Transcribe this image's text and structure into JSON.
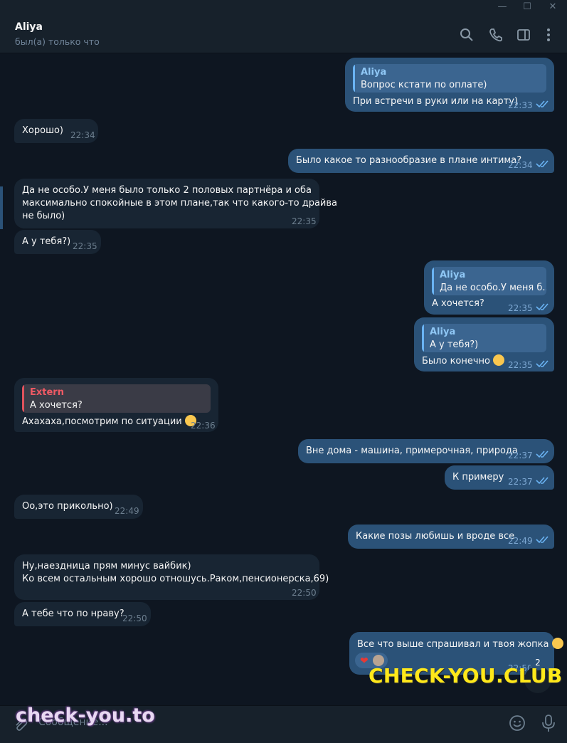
{
  "window": {
    "minimize": "—",
    "maximize": "☐",
    "close": "✕"
  },
  "header": {
    "name": "Aliya",
    "status": "был(а) только что"
  },
  "messages": [
    {
      "quote_name": "Aliya",
      "quote_text": "Вопрос кстати по оплате)",
      "text": "При встречи в руки или на карту)",
      "time": "22:33"
    },
    {
      "text": "Хорошо)",
      "time": "22:34"
    },
    {
      "text": "Было какое то разнообразие в плане интима?",
      "time": "22:34"
    },
    {
      "line1": "Да не особо.У меня было только 2 половых партнёра и оба",
      "line2": "максимально спокойные в этом плане,так что какого-то драйва",
      "line3": "не было)",
      "time": "22:35"
    },
    {
      "text": "А у тебя?)",
      "time": "22:35"
    },
    {
      "quote_name": "Aliya",
      "quote_text": "Да не особо.У меня б...",
      "text": "А хочется?",
      "time": "22:35"
    },
    {
      "quote_name": "Aliya",
      "quote_text": "А у тебя?)",
      "text": "Было конечно",
      "time": "22:35"
    },
    {
      "quote_name": "Extern",
      "quote_text": "А хочется?",
      "text": "Ахахаха,посмотрим по ситуации",
      "time": "22:36"
    },
    {
      "text": "Вне дома - машина, примерочная, природа",
      "time": "22:37"
    },
    {
      "text": "К примеру",
      "time": "22:37"
    },
    {
      "text": "Оо,это прикольно)",
      "time": "22:49"
    },
    {
      "text": "Какие позы любишь и вроде все",
      "time": "22:49"
    },
    {
      "line1": "Ну,наездница прям минус вайбик)",
      "line2": "Ко всем остальным хорошо отношусь.Раком,пенсионерска,69)",
      "time": "22:50"
    },
    {
      "text": "А тебе что по нраву?",
      "time": "22:50"
    },
    {
      "text": "Все что выше спрашивал и твоя жопка",
      "time": "22:50",
      "reaction": "❤"
    }
  ],
  "unread_badge": "2",
  "composer": {
    "placeholder": "Сообщение..."
  },
  "watermarks": {
    "top": "CHECK-YOU.CLUB",
    "bottom": "check-you.to"
  },
  "colors": {
    "bg": "#0e1621",
    "incoming": "#182533",
    "outgoing": "#2b5278",
    "accent": "#6ab3f3"
  }
}
